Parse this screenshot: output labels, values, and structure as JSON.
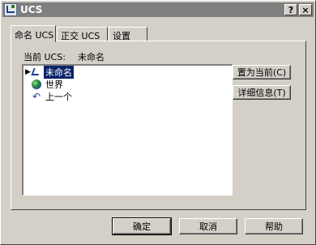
{
  "window": {
    "title": "UCS",
    "help_glyph": "?",
    "close_glyph": "×"
  },
  "tabs": [
    {
      "label": "命名 UCS",
      "active": true
    },
    {
      "label": "正交 UCS",
      "active": false
    },
    {
      "label": "设置",
      "active": false
    }
  ],
  "current": {
    "label": "当前 UCS:",
    "value": "未命名"
  },
  "list": {
    "items": [
      {
        "label": "未命名",
        "icon": "ucs-icon",
        "selected": true
      },
      {
        "label": "世界",
        "icon": "globe-icon",
        "selected": false
      },
      {
        "label": "上一个",
        "icon": "previous-icon",
        "selected": false
      }
    ]
  },
  "side_buttons": {
    "set_current": "置为当前(C)",
    "details": "详细信息(T)"
  },
  "footer": {
    "ok": "确定",
    "cancel": "取消",
    "help": "帮助"
  },
  "colors": {
    "selection": "#0a246a",
    "face": "#d4d0c8",
    "titlebar_inactive": "#7f7f7f"
  }
}
